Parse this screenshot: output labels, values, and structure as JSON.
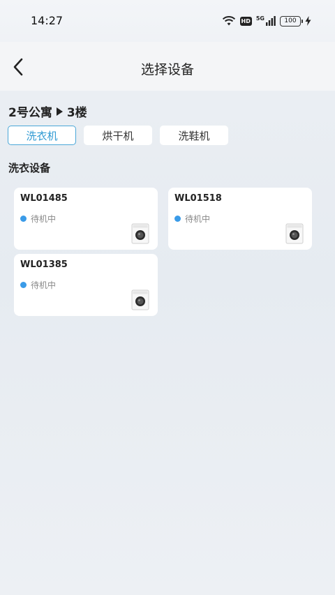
{
  "status_bar": {
    "time": "14:27",
    "network": "5G",
    "hd": "HD",
    "battery": "100",
    "icons": [
      "wifi-icon",
      "hd-icon",
      "signal-5g-icon",
      "battery-icon",
      "charging-icon"
    ]
  },
  "header": {
    "title": "选择设备",
    "back_icon": "chevron-left-icon"
  },
  "location": {
    "building": "2号公寓",
    "floor": "3楼"
  },
  "tabs": [
    {
      "label": "洗衣机",
      "active": true
    },
    {
      "label": "烘干机",
      "active": false
    },
    {
      "label": "洗鞋机",
      "active": false
    }
  ],
  "section": {
    "title": "洗衣设备"
  },
  "devices": [
    {
      "id": "WL01485",
      "status": "待机中",
      "status_color": "#3a9be8",
      "icon": "washing-machine-icon"
    },
    {
      "id": "WL01518",
      "status": "待机中",
      "status_color": "#3a9be8",
      "icon": "washing-machine-icon"
    },
    {
      "id": "WL01385",
      "status": "待机中",
      "status_color": "#3a9be8",
      "icon": "washing-machine-icon"
    }
  ],
  "colors": {
    "accent": "#2f9ad3",
    "status_idle": "#3a9be8"
  }
}
